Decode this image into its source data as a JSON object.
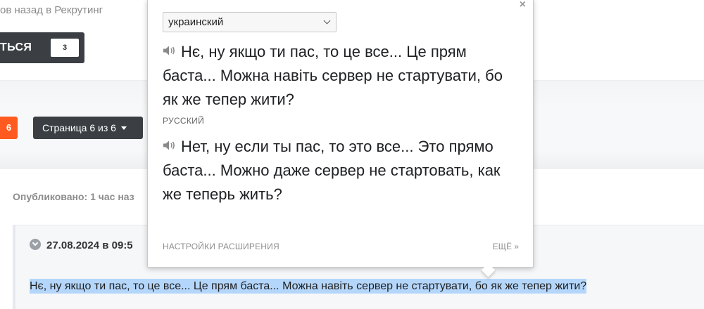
{
  "breadcrumb": "ов назад в Рекрутинг",
  "follow_button": {
    "label": "ТЬСЯ",
    "count": "3"
  },
  "pagination": {
    "current_page": "6",
    "dropdown_label": "Страница 6 из 6"
  },
  "post": {
    "published": "Опубликовано: 1 час наз",
    "date": "27.08.2024 в 09:5",
    "text": "Нє, ну якщо ти пас, то це все... Це прям баста... Можна навіть сервер не стартувати, бо як же тепер жити?"
  },
  "translate_popup": {
    "source_language": "украинский",
    "source_text": "Нє, ну якщо ти пас, то це все... Це прям баста... Можна навіть сервер не стартувати, бо як же тепер жити?",
    "target_language": "РУССКИЙ",
    "translated_text": "Нет, ну если ты пас, то это все... Это прямо баста... Можно даже сервер не стартовать, как же теперь жить?",
    "settings_link": "НАСТРОЙКИ РАСШИРЕНИЯ",
    "more_link": "ЕЩЁ »",
    "close": "×"
  },
  "colors": {
    "accent": "#ff5a1f",
    "dark_button": "#3b3f44",
    "selection": "#b4d6fb"
  }
}
